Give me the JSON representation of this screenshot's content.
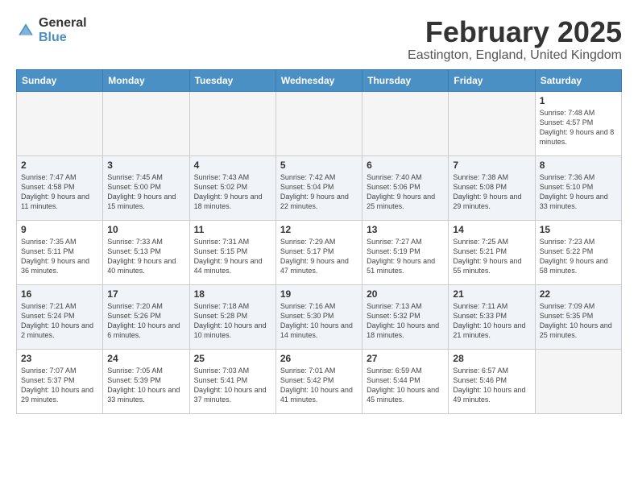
{
  "logo": {
    "general": "General",
    "blue": "Blue"
  },
  "title": "February 2025",
  "subtitle": "Eastington, England, United Kingdom",
  "weekdays": [
    "Sunday",
    "Monday",
    "Tuesday",
    "Wednesday",
    "Thursday",
    "Friday",
    "Saturday"
  ],
  "weeks": [
    [
      {
        "day": "",
        "info": ""
      },
      {
        "day": "",
        "info": ""
      },
      {
        "day": "",
        "info": ""
      },
      {
        "day": "",
        "info": ""
      },
      {
        "day": "",
        "info": ""
      },
      {
        "day": "",
        "info": ""
      },
      {
        "day": "1",
        "info": "Sunrise: 7:48 AM\nSunset: 4:57 PM\nDaylight: 9 hours and 8 minutes."
      }
    ],
    [
      {
        "day": "2",
        "info": "Sunrise: 7:47 AM\nSunset: 4:58 PM\nDaylight: 9 hours and 11 minutes."
      },
      {
        "day": "3",
        "info": "Sunrise: 7:45 AM\nSunset: 5:00 PM\nDaylight: 9 hours and 15 minutes."
      },
      {
        "day": "4",
        "info": "Sunrise: 7:43 AM\nSunset: 5:02 PM\nDaylight: 9 hours and 18 minutes."
      },
      {
        "day": "5",
        "info": "Sunrise: 7:42 AM\nSunset: 5:04 PM\nDaylight: 9 hours and 22 minutes."
      },
      {
        "day": "6",
        "info": "Sunrise: 7:40 AM\nSunset: 5:06 PM\nDaylight: 9 hours and 25 minutes."
      },
      {
        "day": "7",
        "info": "Sunrise: 7:38 AM\nSunset: 5:08 PM\nDaylight: 9 hours and 29 minutes."
      },
      {
        "day": "8",
        "info": "Sunrise: 7:36 AM\nSunset: 5:10 PM\nDaylight: 9 hours and 33 minutes."
      }
    ],
    [
      {
        "day": "9",
        "info": "Sunrise: 7:35 AM\nSunset: 5:11 PM\nDaylight: 9 hours and 36 minutes."
      },
      {
        "day": "10",
        "info": "Sunrise: 7:33 AM\nSunset: 5:13 PM\nDaylight: 9 hours and 40 minutes."
      },
      {
        "day": "11",
        "info": "Sunrise: 7:31 AM\nSunset: 5:15 PM\nDaylight: 9 hours and 44 minutes."
      },
      {
        "day": "12",
        "info": "Sunrise: 7:29 AM\nSunset: 5:17 PM\nDaylight: 9 hours and 47 minutes."
      },
      {
        "day": "13",
        "info": "Sunrise: 7:27 AM\nSunset: 5:19 PM\nDaylight: 9 hours and 51 minutes."
      },
      {
        "day": "14",
        "info": "Sunrise: 7:25 AM\nSunset: 5:21 PM\nDaylight: 9 hours and 55 minutes."
      },
      {
        "day": "15",
        "info": "Sunrise: 7:23 AM\nSunset: 5:22 PM\nDaylight: 9 hours and 58 minutes."
      }
    ],
    [
      {
        "day": "16",
        "info": "Sunrise: 7:21 AM\nSunset: 5:24 PM\nDaylight: 10 hours and 2 minutes."
      },
      {
        "day": "17",
        "info": "Sunrise: 7:20 AM\nSunset: 5:26 PM\nDaylight: 10 hours and 6 minutes."
      },
      {
        "day": "18",
        "info": "Sunrise: 7:18 AM\nSunset: 5:28 PM\nDaylight: 10 hours and 10 minutes."
      },
      {
        "day": "19",
        "info": "Sunrise: 7:16 AM\nSunset: 5:30 PM\nDaylight: 10 hours and 14 minutes."
      },
      {
        "day": "20",
        "info": "Sunrise: 7:13 AM\nSunset: 5:32 PM\nDaylight: 10 hours and 18 minutes."
      },
      {
        "day": "21",
        "info": "Sunrise: 7:11 AM\nSunset: 5:33 PM\nDaylight: 10 hours and 21 minutes."
      },
      {
        "day": "22",
        "info": "Sunrise: 7:09 AM\nSunset: 5:35 PM\nDaylight: 10 hours and 25 minutes."
      }
    ],
    [
      {
        "day": "23",
        "info": "Sunrise: 7:07 AM\nSunset: 5:37 PM\nDaylight: 10 hours and 29 minutes."
      },
      {
        "day": "24",
        "info": "Sunrise: 7:05 AM\nSunset: 5:39 PM\nDaylight: 10 hours and 33 minutes."
      },
      {
        "day": "25",
        "info": "Sunrise: 7:03 AM\nSunset: 5:41 PM\nDaylight: 10 hours and 37 minutes."
      },
      {
        "day": "26",
        "info": "Sunrise: 7:01 AM\nSunset: 5:42 PM\nDaylight: 10 hours and 41 minutes."
      },
      {
        "day": "27",
        "info": "Sunrise: 6:59 AM\nSunset: 5:44 PM\nDaylight: 10 hours and 45 minutes."
      },
      {
        "day": "28",
        "info": "Sunrise: 6:57 AM\nSunset: 5:46 PM\nDaylight: 10 hours and 49 minutes."
      },
      {
        "day": "",
        "info": ""
      }
    ]
  ]
}
